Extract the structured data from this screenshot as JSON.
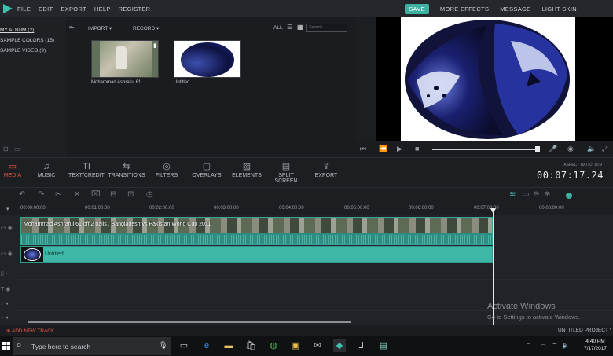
{
  "menu": {
    "items": [
      "FILE",
      "EDIT",
      "EXPORT",
      "HELP",
      "REGISTER"
    ],
    "save": "SAVE",
    "more_effects": "MORE EFFECTS",
    "message": "MESSAGE",
    "light_skin": "LIGHT SKIN"
  },
  "library": {
    "items": [
      "MY ALBUM (2)",
      "SAMPLE COLORS (15)",
      "SAMPLE VIDEO (9)"
    ]
  },
  "media": {
    "import": "IMPORT",
    "record": "RECORD",
    "all": "ALL",
    "search_placeholder": "Search",
    "items": [
      {
        "label": "Mohammad Ashraful 61 ..."
      },
      {
        "label": "Untitled"
      }
    ]
  },
  "tabs": [
    "MEDIA",
    "MUSIC",
    "TEXT/CREDIT",
    "TRANSITIONS",
    "FILTERS",
    "OVERLAYS",
    "ELEMENTS",
    "SPLIT SCREEN",
    "EXPORT"
  ],
  "aspect_ratio": "ASPECT RATIO: 16:9",
  "timecode": "00:07:17.24",
  "ruler": [
    "00:00:00:00",
    "00:01:00:00",
    "00:02:00:00",
    "00:03:00:00",
    "00:04:00:00",
    "00:05:00:00",
    "00:06:00:00",
    "00:07:00:00",
    "00:08:00:00"
  ],
  "clips": {
    "video_name": "Mohammad Ashraful 61 off 2 balls , Bangladesh vs Pakistan World Cup 2011",
    "image_name": "Untitled"
  },
  "add_track": "ADD NEW TRACK",
  "project": "UNTITLED PROJECT *",
  "activate": {
    "title": "Activate Windows",
    "sub": "Go to Settings to activate Windows."
  },
  "taskbar": {
    "search": "Type here to search",
    "time": "4:40 PM",
    "date": "7/17/2017"
  },
  "colors": {
    "accent": "#3fb1a3",
    "active_tab": "#e9574a"
  }
}
